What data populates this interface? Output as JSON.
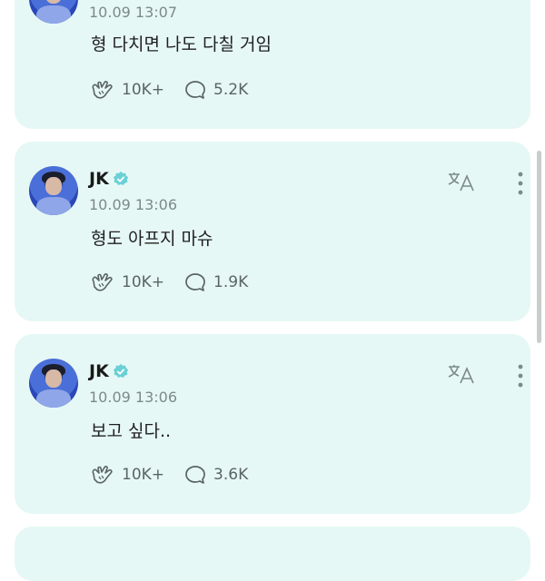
{
  "posts": [
    {
      "author": "",
      "time": "10.09 13:07",
      "text": "형 다치면 나도 다칠 거임",
      "likes": "10K+",
      "comments": "5.2K"
    },
    {
      "author": "JK",
      "time": "10.09 13:06",
      "text": "형도 아프지 마슈",
      "likes": "10K+",
      "comments": "1.9K"
    },
    {
      "author": "JK",
      "time": "10.09 13:06",
      "text": "보고 싶다..",
      "likes": "10K+",
      "comments": "3.6K"
    }
  ],
  "colors": {
    "card_bg": "#e6f8f5",
    "verified": "#6bd0d6",
    "meta_text": "#7c8a88"
  },
  "icons": [
    "like-icon",
    "comment-icon",
    "translate-icon",
    "more-options-icon",
    "verified-badge-icon"
  ]
}
